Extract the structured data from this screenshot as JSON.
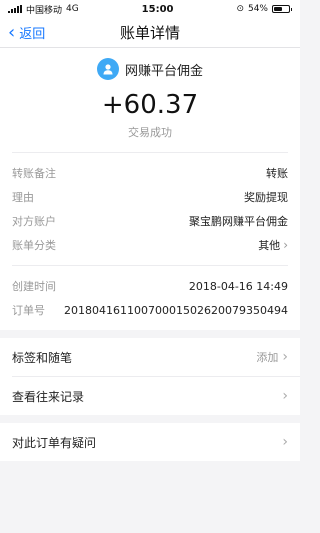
{
  "status_bar": {
    "carrier": "中国移动",
    "network": "4G",
    "time": "15:00",
    "battery": "54%"
  },
  "nav": {
    "back_label": "返回",
    "title": "账单详情"
  },
  "summary": {
    "merchant_name": "网赚平台佣金",
    "amount": "+60.37",
    "status": "交易成功"
  },
  "details": [
    {
      "label": "转账备注",
      "value": "转账"
    },
    {
      "label": "理由",
      "value": "奖励提现"
    },
    {
      "label": "对方账户",
      "value": "聚宝鹏网赚平台佣金"
    },
    {
      "label": "账单分类",
      "value": "其他"
    }
  ],
  "details2": [
    {
      "label": "创建时间",
      "value": "2018-04-16 14:49"
    },
    {
      "label": "订单号",
      "value": "20180416110070001502620079350494"
    }
  ],
  "menu": {
    "tags": {
      "label": "标签和随笔",
      "action": "添加"
    },
    "history": {
      "label": "查看往来记录"
    },
    "question": {
      "label": "对此订单有疑问"
    }
  }
}
